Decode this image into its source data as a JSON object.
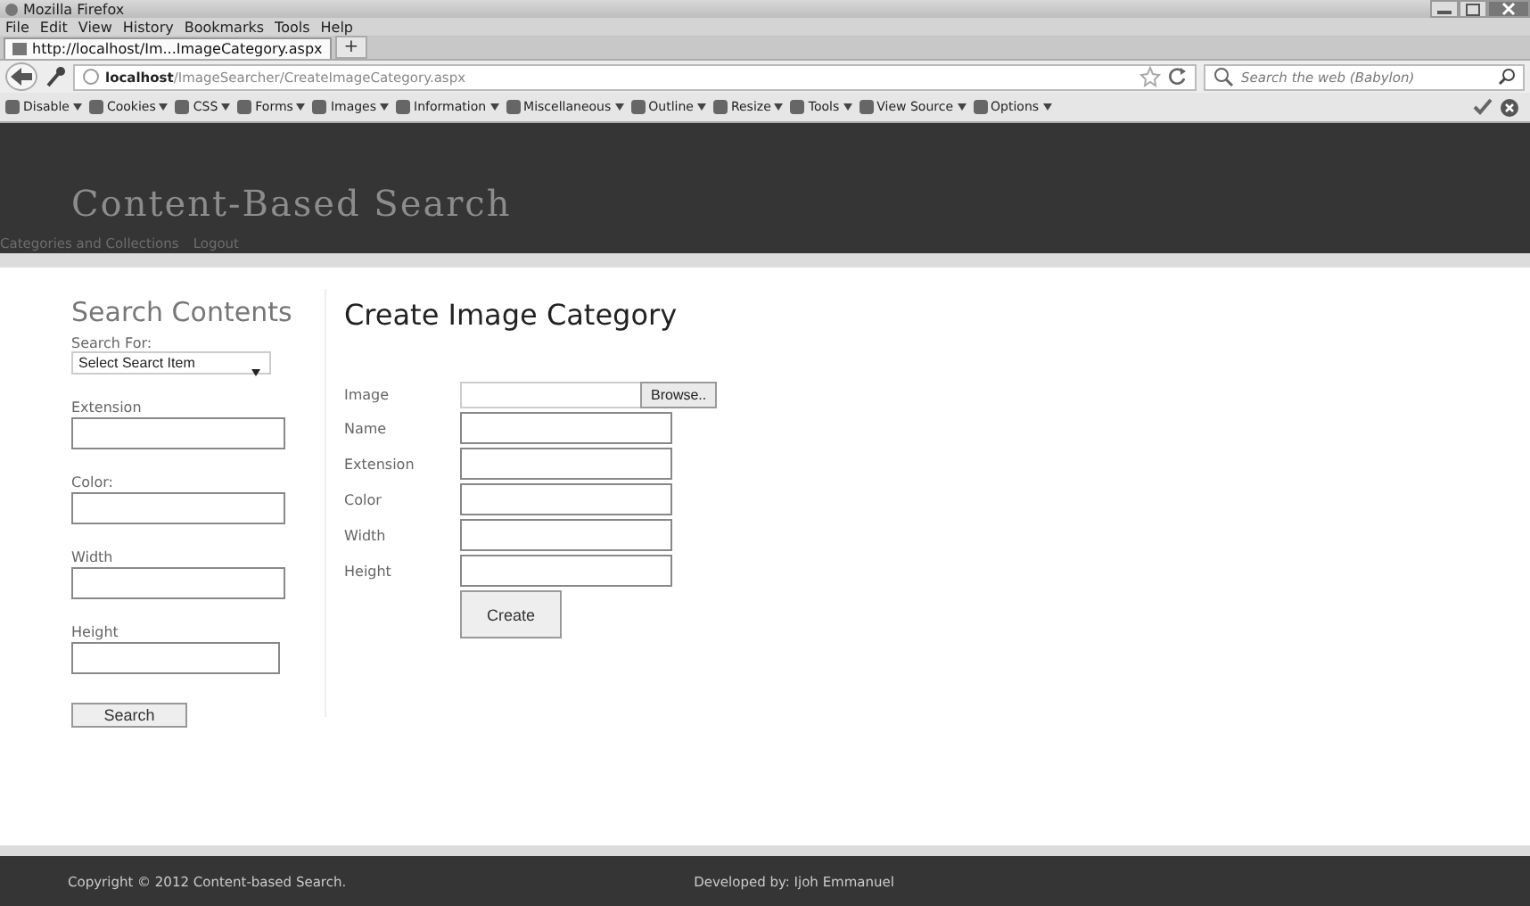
{
  "window": {
    "title": "Mozilla Firefox"
  },
  "menu": [
    "File",
    "Edit",
    "View",
    "History",
    "Bookmarks",
    "Tools",
    "Help"
  ],
  "tabs": [
    {
      "label": "http://localhost/Im...ImageCategory.aspx",
      "selected": true
    }
  ],
  "new_tab": "+",
  "address": {
    "host": "localhost",
    "path": "/ImageSearcher/CreateImageCategory.aspx"
  },
  "search": {
    "placeholder": "Search the web (Babylon)"
  },
  "toolbar": [
    "Disable",
    "Cookies",
    "CSS",
    "Forms",
    "Images",
    "Information",
    "Miscellaneous",
    "Outline",
    "Resize",
    "Tools",
    "View Source",
    "Options"
  ],
  "site": {
    "title": "Content-Based Search",
    "links": [
      "Categories and Collections",
      "Logout"
    ]
  },
  "sidebar": {
    "heading": "Search Contents",
    "select_label": "Search For:",
    "select_value": "Select Searct Item",
    "fields": [
      "Extension",
      "Color:",
      "Width",
      "Height"
    ],
    "button": "Search"
  },
  "main": {
    "heading": "Create Image Category",
    "file_label": "Image",
    "browse": "Browse..",
    "fields": [
      "Name",
      "Extension",
      "Color",
      "Width",
      "Height"
    ],
    "button": "Create"
  },
  "footer": {
    "copyright": "Copyright © 2012 Content-based Search.",
    "developer": "Developed by: Ijoh Emmanuel"
  }
}
